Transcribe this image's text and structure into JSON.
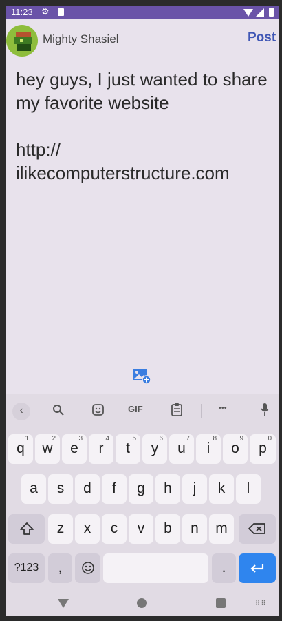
{
  "status_bar": {
    "time": "11:23"
  },
  "header": {
    "username": "Mighty Shasiel",
    "post_label": "Post"
  },
  "compose": {
    "text": "hey guys, I just wanted to share my favorite website\n\nhttp://\nilikecomputerstructure.com"
  },
  "keyboard": {
    "suggestion_bar": {
      "back": "‹",
      "gif": "GIF",
      "more": "•••"
    },
    "row1": [
      {
        "k": "q",
        "n": "1"
      },
      {
        "k": "w",
        "n": "2"
      },
      {
        "k": "e",
        "n": "3"
      },
      {
        "k": "r",
        "n": "4"
      },
      {
        "k": "t",
        "n": "5"
      },
      {
        "k": "y",
        "n": "6"
      },
      {
        "k": "u",
        "n": "7"
      },
      {
        "k": "i",
        "n": "8"
      },
      {
        "k": "o",
        "n": "9"
      },
      {
        "k": "p",
        "n": "0"
      }
    ],
    "row2": [
      "a",
      "s",
      "d",
      "f",
      "g",
      "h",
      "j",
      "k",
      "l"
    ],
    "row3": [
      "z",
      "x",
      "c",
      "v",
      "b",
      "n",
      "m"
    ],
    "row4": {
      "symbols": "?123",
      "comma": ",",
      "period": "."
    }
  }
}
